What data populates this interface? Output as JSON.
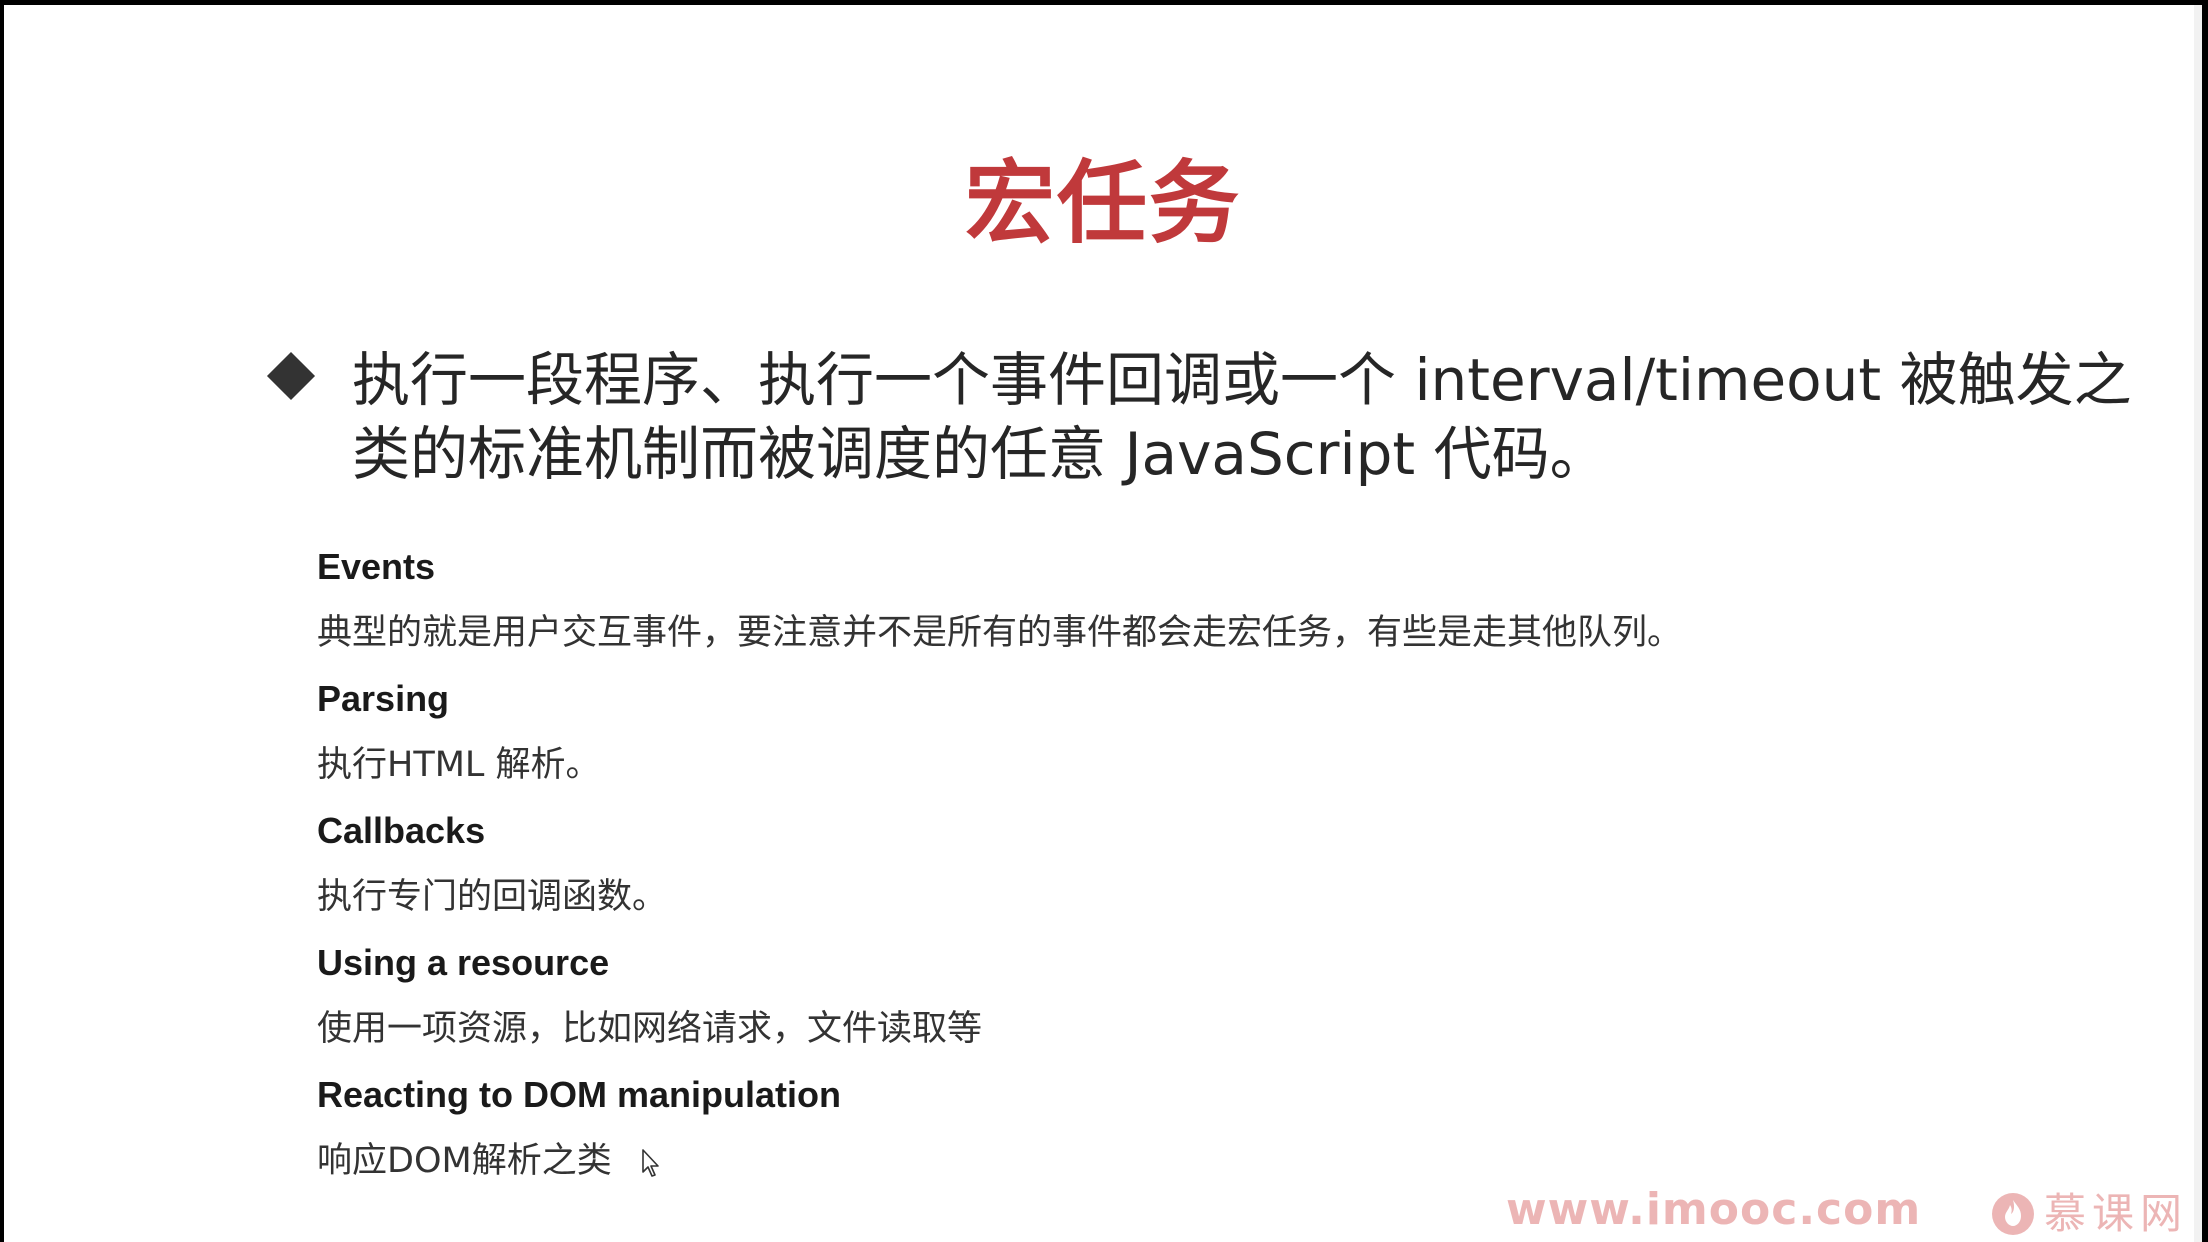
{
  "slide": {
    "title": "宏任务",
    "bullet": "执行一段程序、执行一个事件回调或一个 interval/timeout 被触发之类的标准机制而被调度的任意 JavaScript 代码。",
    "items": [
      {
        "heading": "Events",
        "description": "典型的就是用户交互事件，要注意并不是所有的事件都会走宏任务，有些是走其他队列。"
      },
      {
        "heading": "Parsing",
        "description": "执行HTML 解析。"
      },
      {
        "heading": "Callbacks",
        "description": "执行专门的回调函数。"
      },
      {
        "heading": "Using a resource",
        "description": "使用一项资源，比如网络请求，文件读取等"
      },
      {
        "heading": "Reacting to DOM manipulation",
        "description": "响应DOM解析之类"
      }
    ]
  },
  "watermark": {
    "url": "www.imooc.com",
    "brand": "慕课网"
  },
  "colors": {
    "title": "#c0393b",
    "watermark": "#dc7878"
  }
}
